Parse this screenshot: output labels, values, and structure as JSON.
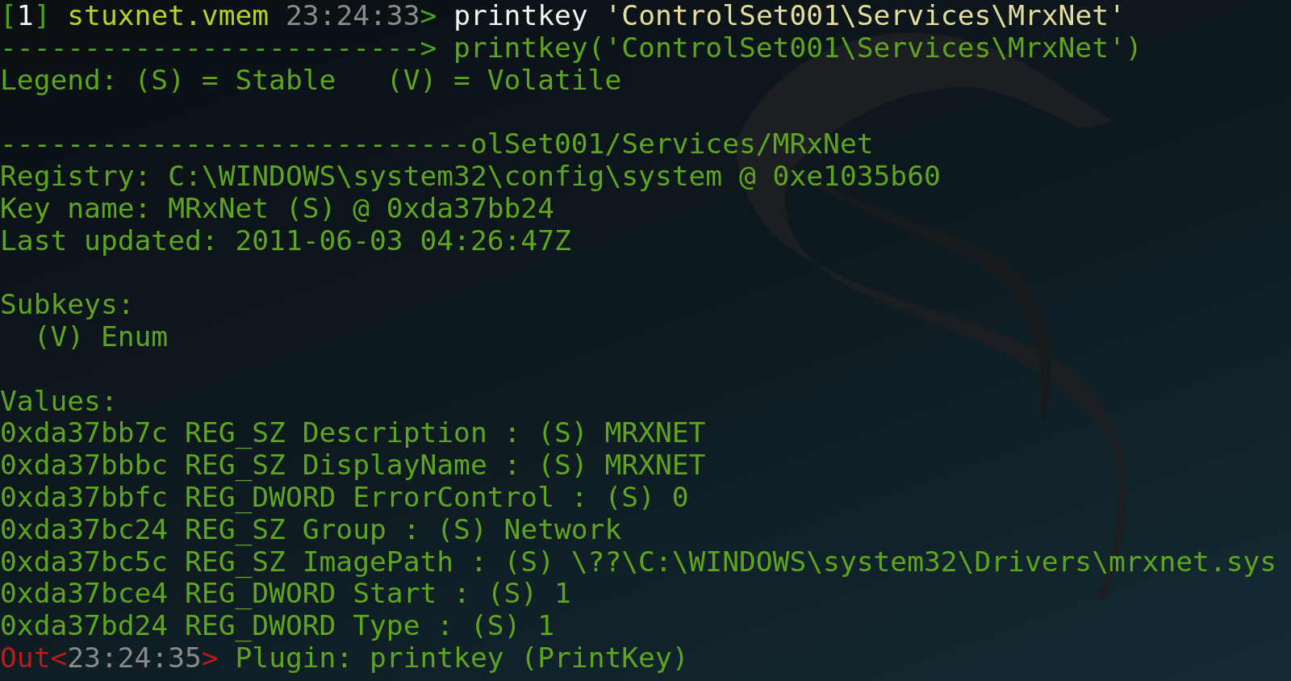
{
  "terminal": {
    "lines": [
      {
        "kind": "parts",
        "parts": [
          {
            "kind": "bracket",
            "text": "["
          },
          {
            "kind": "number",
            "text": "1"
          },
          {
            "kind": "bracket",
            "text": "]"
          },
          {
            "kind": "db",
            "text": " stuxnet.vmem"
          },
          {
            "kind": "time",
            "text": " 23:24:33"
          },
          {
            "kind": "arrow",
            "text": ">"
          },
          {
            "kind": "command",
            "text": " printkey "
          },
          {
            "kind": "string",
            "text": "'ControlSet001\\Services\\MrxNet'"
          }
        ]
      },
      {
        "kind": "parts",
        "parts": [
          {
            "kind": "arrow",
            "text": "------------------------->"
          },
          {
            "kind": "output",
            "text": " printkey('ControlSet001\\Services\\MrxNet')"
          }
        ]
      },
      {
        "kind": "text",
        "text": "Legend: (S) = Stable   (V) = Volatile"
      },
      {
        "kind": "blank"
      },
      {
        "kind": "text",
        "text": "----------------------------olSet001/Services/MRxNet"
      },
      {
        "kind": "text",
        "text": "Registry: C:\\WINDOWS\\system32\\config\\system @ 0xe1035b60"
      },
      {
        "kind": "text",
        "text": "Key name: MRxNet (S) @ 0xda37bb24"
      },
      {
        "kind": "text",
        "text": "Last updated: 2011-06-03 04:26:47Z"
      },
      {
        "kind": "blank"
      },
      {
        "kind": "text",
        "text": "Subkeys:"
      },
      {
        "kind": "text",
        "text": "  (V) Enum"
      },
      {
        "kind": "blank"
      },
      {
        "kind": "text",
        "text": "Values:"
      },
      {
        "kind": "text",
        "text": "0xda37bb7c REG_SZ Description : (S) MRXNET"
      },
      {
        "kind": "text",
        "text": "0xda37bbbc REG_SZ DisplayName : (S) MRXNET"
      },
      {
        "kind": "text",
        "text": "0xda37bbfc REG_DWORD ErrorControl : (S) 0"
      },
      {
        "kind": "text",
        "text": "0xda37bc24 REG_SZ Group : (S) Network"
      },
      {
        "kind": "text",
        "text": "0xda37bc5c REG_SZ ImagePath : (S) \\??\\C:\\WINDOWS\\system32\\Drivers\\mrxnet.sys"
      },
      {
        "kind": "text",
        "text": "0xda37bce4 REG_DWORD Start : (S) 1"
      },
      {
        "kind": "text",
        "text": "0xda37bd24 REG_DWORD Type : (S) 1"
      },
      {
        "kind": "parts",
        "parts": [
          {
            "kind": "out",
            "text": "Out"
          },
          {
            "kind": "out",
            "text": "<"
          },
          {
            "kind": "time",
            "text": "23:24:35"
          },
          {
            "kind": "out",
            "text": ">"
          },
          {
            "kind": "output",
            "text": " Plugin: printkey (PrintKey)"
          }
        ]
      }
    ]
  }
}
